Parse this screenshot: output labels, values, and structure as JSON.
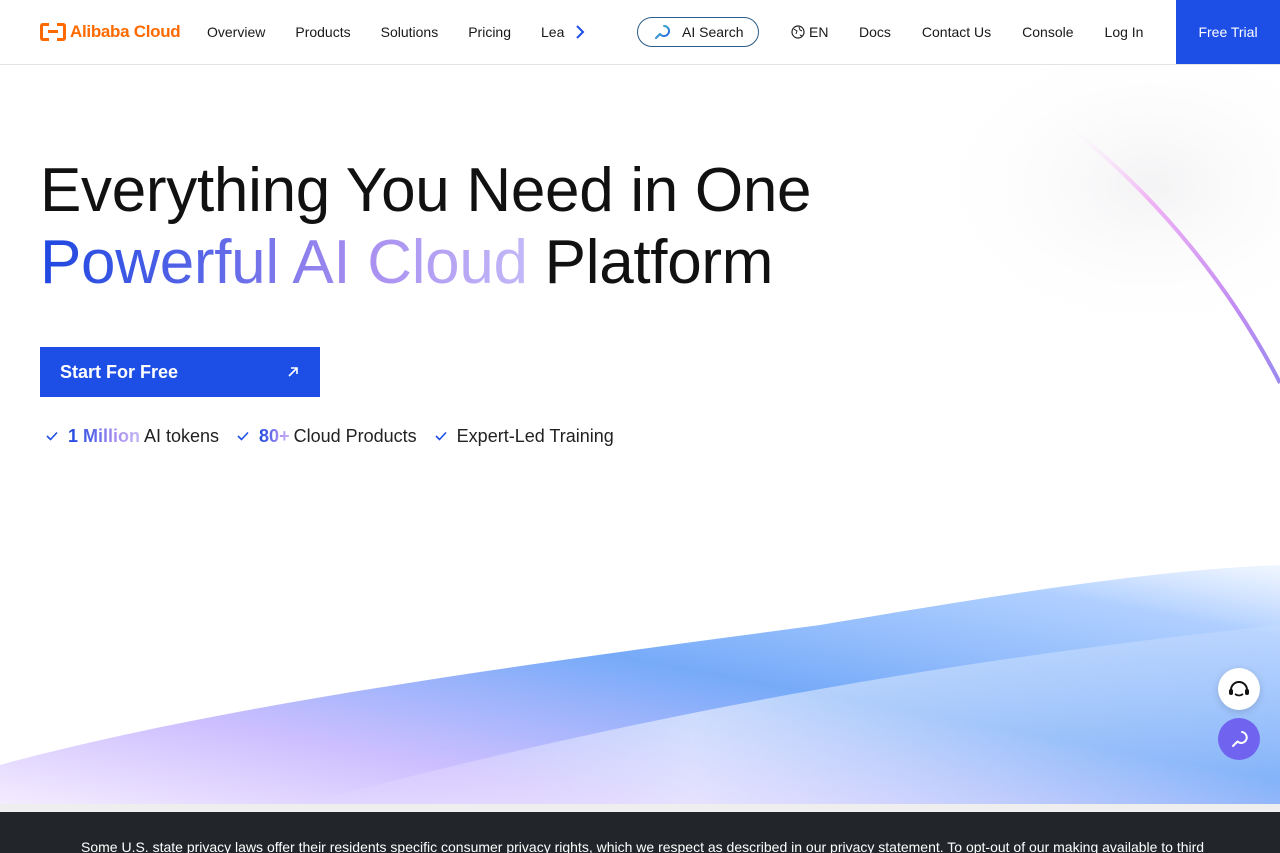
{
  "header": {
    "logo_text": "Alibaba Cloud",
    "nav": [
      "Overview",
      "Products",
      "Solutions",
      "Pricing"
    ],
    "nav_clipped": "Lea",
    "ai_search_label": "AI Search",
    "language": "EN",
    "right_nav": [
      "Docs",
      "Contact Us",
      "Console",
      "Log In"
    ],
    "cta_label": "Free Trial"
  },
  "hero": {
    "title_line1": "Everything You Need in One",
    "title_line2_highlight": "Powerful AI Cloud",
    "title_line2_rest": " Platform",
    "cta_label": "Start For Free",
    "features": [
      {
        "highlight": "1 Million",
        "text": "AI tokens"
      },
      {
        "highlight": "80+",
        "text": "Cloud Products"
      },
      {
        "highlight": "",
        "text": "Expert-Led Training"
      }
    ]
  },
  "cookie_banner": {
    "text": "Some U.S. state privacy laws offer their residents specific consumer privacy rights, which we respect as described in our privacy statement. To opt-out of our making available to third"
  },
  "colors": {
    "brand_orange": "#ff6a00",
    "primary_blue": "#1d4ee6",
    "banner_dark": "#22262b"
  },
  "icons": {
    "ai_search": "ai-search-icon",
    "language": "globe-icon",
    "nav_more": "chevron-right-icon",
    "cta": "arrow-up-right-icon",
    "feature": "check-icon",
    "support": "headset-icon",
    "ai_assistant": "ai-assistant-icon"
  }
}
